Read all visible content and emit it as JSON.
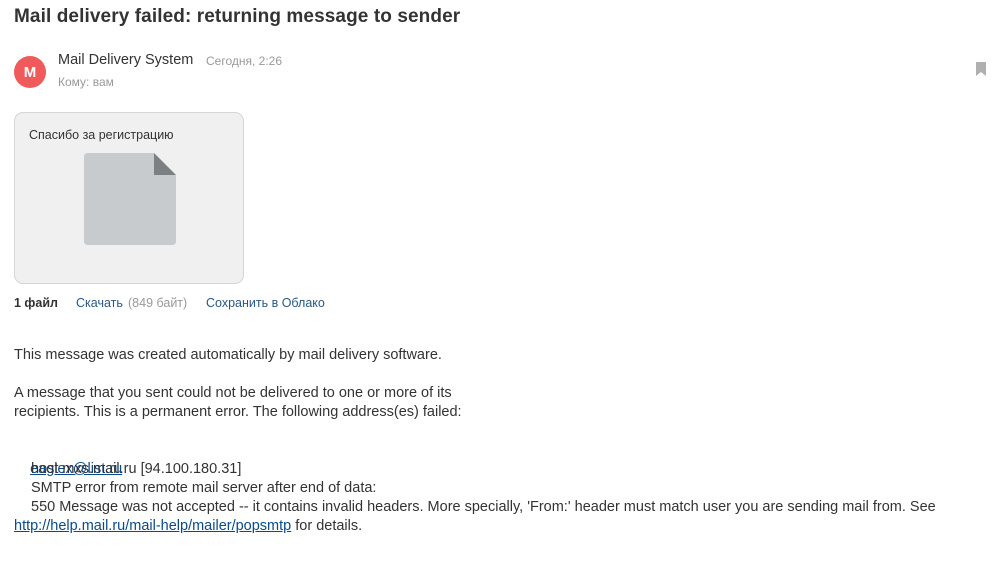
{
  "subject": "Mail delivery failed: returning message to sender",
  "sender": {
    "avatar_letter": "M",
    "avatar_color": "#f05a5a",
    "name": "Mail Delivery System",
    "time": "Сегодня, 2:26",
    "to": "Кому: вам"
  },
  "icons": {
    "bookmark": "bookmark-icon",
    "file": "file-icon"
  },
  "attachment": {
    "name": "Спасибо за регистрацию",
    "count_label": "1 файл",
    "download_label": "Скачать",
    "size_label": "(849 байт)",
    "cloud_label": "Сохранить в Облако"
  },
  "body": {
    "line1": "This message was created automatically by mail delivery software.",
    "line2": "A message that you sent could not be delivered to one or more of its",
    "line3": "recipients. This is a permanent error. The following address(es) failed:",
    "failed_address": "eaglex@list.ru",
    "host_line": "host mxs.mail.ru [94.100.180.31]",
    "smtp_line": "SMTP error from remote mail server after end of data:",
    "error_line": "550 Message was not accepted -- it contains invalid headers. More specially, 'From:' header must match user you are sending mail from. See",
    "help_link": "http://help.mail.ru/mail-help/mailer/popsmtp",
    "details_suffix": " for details."
  }
}
